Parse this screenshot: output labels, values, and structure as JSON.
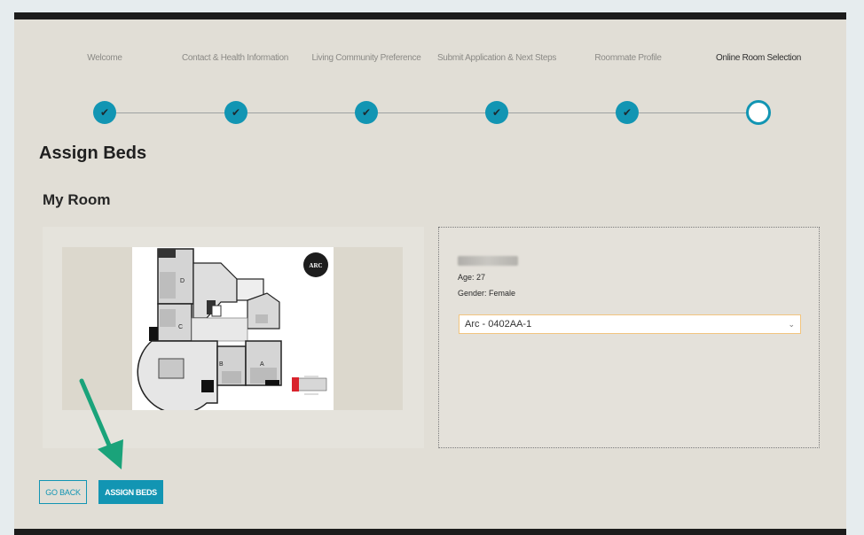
{
  "steps": [
    {
      "label": "Welcome",
      "status": "complete"
    },
    {
      "label": "Contact & Health Information",
      "status": "complete"
    },
    {
      "label": "Living Community Preference",
      "status": "complete"
    },
    {
      "label": "Submit Application & Next Steps",
      "status": "complete"
    },
    {
      "label": "Roommate Profile",
      "status": "complete"
    },
    {
      "label": "Online Room Selection",
      "status": "current"
    }
  ],
  "check_glyph": "✔",
  "page_title": "Assign Beds",
  "section_title": "My Room",
  "floorplan": {
    "logo_text": "ARC",
    "room_labels": [
      "D",
      "C",
      "B",
      "A"
    ]
  },
  "resident": {
    "age_text": "Age: 27",
    "gender_text": "Gender: Female",
    "bed_select_value": "Arc - 0402AA-1"
  },
  "buttons": {
    "go_back": "GO BACK",
    "assign_beds": "ASSIGN BEDS"
  },
  "colors": {
    "accent": "#1295b3",
    "annotation_arrow": "#1aa37a"
  }
}
